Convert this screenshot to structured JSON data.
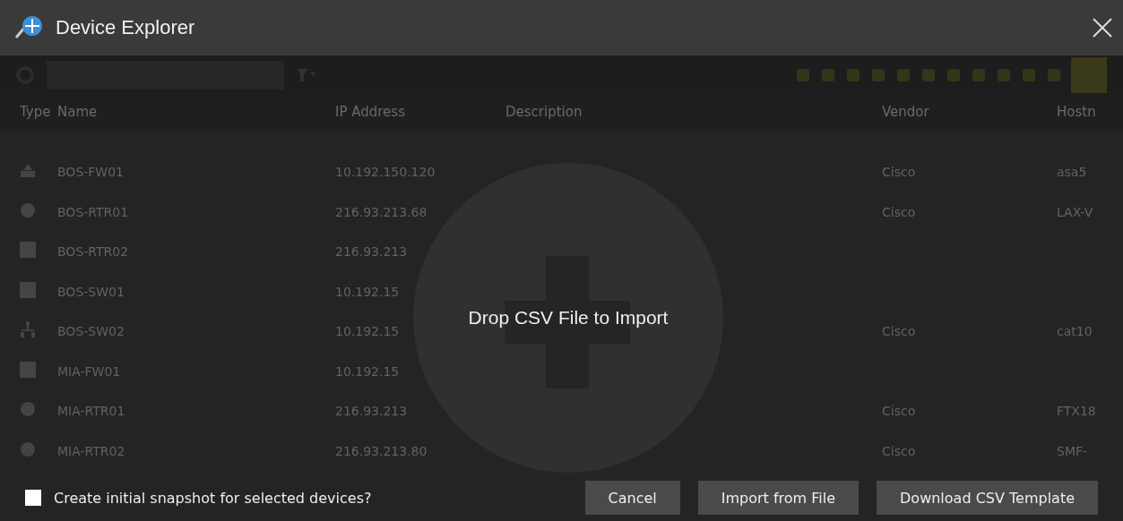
{
  "window": {
    "title": "Device Explorer"
  },
  "table": {
    "columns": [
      "Type",
      "Name",
      "IP Address",
      "Description",
      "Vendor",
      "Hostn"
    ],
    "rows": [
      {
        "kind": "firewall",
        "name": "BOS-FW01",
        "ip": "10.192.150.120",
        "vendor": "Cisco",
        "hostname": "asa5"
      },
      {
        "kind": "router",
        "name": "BOS-RTR01",
        "ip": "216.93.213.68",
        "vendor": "Cisco",
        "hostname": "LAX-V"
      },
      {
        "kind": "generic",
        "name": "BOS-RTR02",
        "ip": "216.93.213"
      },
      {
        "kind": "generic",
        "name": "BOS-SW01",
        "ip": "10.192.15"
      },
      {
        "kind": "switch",
        "name": "BOS-SW02",
        "ip": "10.192.15",
        "vendor": "Cisco",
        "hostname": "cat10"
      },
      {
        "kind": "generic",
        "name": "MIA-FW01",
        "ip": "10.192.15"
      },
      {
        "kind": "router",
        "name": "MIA-RTR01",
        "ip": "216.93.213",
        "vendor": "Cisco",
        "hostname": "FTX18"
      },
      {
        "kind": "router",
        "name": "MIA-RTR02",
        "ip": "216.93.213.80",
        "vendor": "Cisco",
        "hostname": "SMF-"
      }
    ]
  },
  "drop_zone": {
    "message": "Drop CSV File to Import"
  },
  "footer": {
    "snapshot_checkbox": {
      "label": "Create initial snapshot for selected devices?",
      "checked": false
    },
    "buttons": [
      "Cancel",
      "Import from File",
      "Download CSV Template"
    ]
  }
}
